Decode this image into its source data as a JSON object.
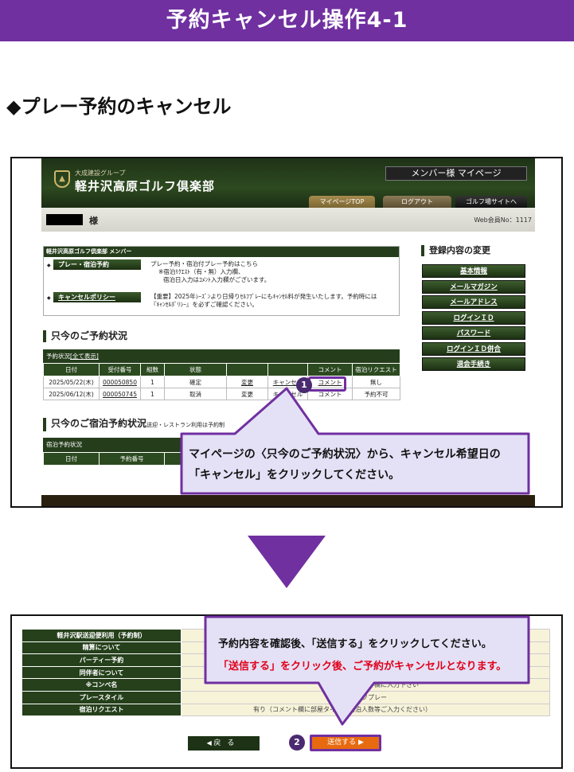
{
  "slide_title": "予約キャンセル操作4-1",
  "section_heading": "◆プレー予約のキャンセル",
  "site": {
    "group_name": "大成建設グループ",
    "club_name": "軽井沢高原ゴルフ倶楽部",
    "mypage_label": "メンバー様 マイページ",
    "nav": [
      "マイページTOP",
      "ログアウト",
      "ゴルフ場サイトへ"
    ],
    "user_suffix": "様",
    "web_member_no": "Web会員No：1117",
    "member_box_title": "軽井沢高原ゴルフ倶楽部 メンバー",
    "play_btn": "プレー・宿泊予約",
    "play_desc1": "プレー予約・宿泊付プレー予約はこちら",
    "play_desc2": "※宿泊ﾘｸｴｽﾄ（有・無）入力欄、",
    "play_desc3": "宿泊日入力はｺﾒﾝﾄ入力欄がございます。",
    "policy_btn": "キャンセルポリシー",
    "policy_desc1": "【重要】2025年ｼｰｽﾞﾝより日帰りｾﾙﾌﾌﾟﾚｰにもｷｬﾝｾﾙ料が発生いたします。予約時には",
    "policy_desc2": "『ｷｬﾝｾﾙﾎﾟﾘｼｰ』を必ずご確認ください。",
    "reg_heading": "登録内容の変更",
    "reg_buttons": [
      "基本情報",
      "メールマガジン",
      "メールアドレス",
      "ログインＩＤ",
      "パスワード",
      "ログインＩＤ併合",
      "退会手続き"
    ],
    "reservation_heading": "只今のご予約状況",
    "reservation_table_title": "予約状況",
    "show_all": "[全て表示]",
    "reservation_columns": [
      "日付",
      "受付番号",
      "組数",
      "状態",
      "",
      "",
      "コメント",
      "宿泊リクエスト"
    ],
    "reservations": [
      {
        "date": "2025/05/22(木)",
        "no": "000050850",
        "groups": "1",
        "status": "確定",
        "change": "変更",
        "cancel": "キャンセル",
        "comment": "コメント",
        "stay": "無し"
      },
      {
        "date": "2025/06/12(木)",
        "no": "000050745",
        "groups": "1",
        "status": "取消",
        "change": "変更",
        "cancel": "キャンセル",
        "comment": "コメント",
        "stay": "予約不可"
      }
    ],
    "stay_heading": "只今のご宿泊予約状況",
    "stay_note": "送迎・レストラン利用は予約制",
    "stay_table_title": "宿泊予約状況",
    "stay_columns": [
      "日付",
      "予約番号"
    ]
  },
  "step1": {
    "badge": "1",
    "callout_line1": "マイページの〈只今のご予約状況〉から、キャンセル希望日の",
    "callout_line2": "「キャンセル」をクリックしてください。"
  },
  "form": {
    "rows": [
      {
        "label": "軽井沢駅送迎便利用（予約制）",
        "value": ""
      },
      {
        "label": "精算について",
        "value": ""
      },
      {
        "label": "パーティー予約",
        "value": ""
      },
      {
        "label": "同伴者について",
        "value": ""
      },
      {
        "label": "※コンペ名",
        "value": "コメント欄に入力下さい"
      },
      {
        "label": "プレースタイル",
        "value": "セルフプレー"
      },
      {
        "label": "宿泊リクエスト",
        "value": "有り（コメント欄に部屋タイプ・宿泊人数等ご入力ください）"
      }
    ],
    "back_label": "戻る",
    "send_label": "送信する"
  },
  "step2": {
    "badge": "2",
    "callout_line1": "予約内容を確認後、「送信する」をクリックしてください。",
    "callout_line2": "「送信する」をクリック後、ご予約がキャンセルとなります。"
  },
  "colors": {
    "accent": "#7030a0",
    "site_green": "#253d1b",
    "send_orange": "#e86a10",
    "warning_red": "#e0001a"
  }
}
